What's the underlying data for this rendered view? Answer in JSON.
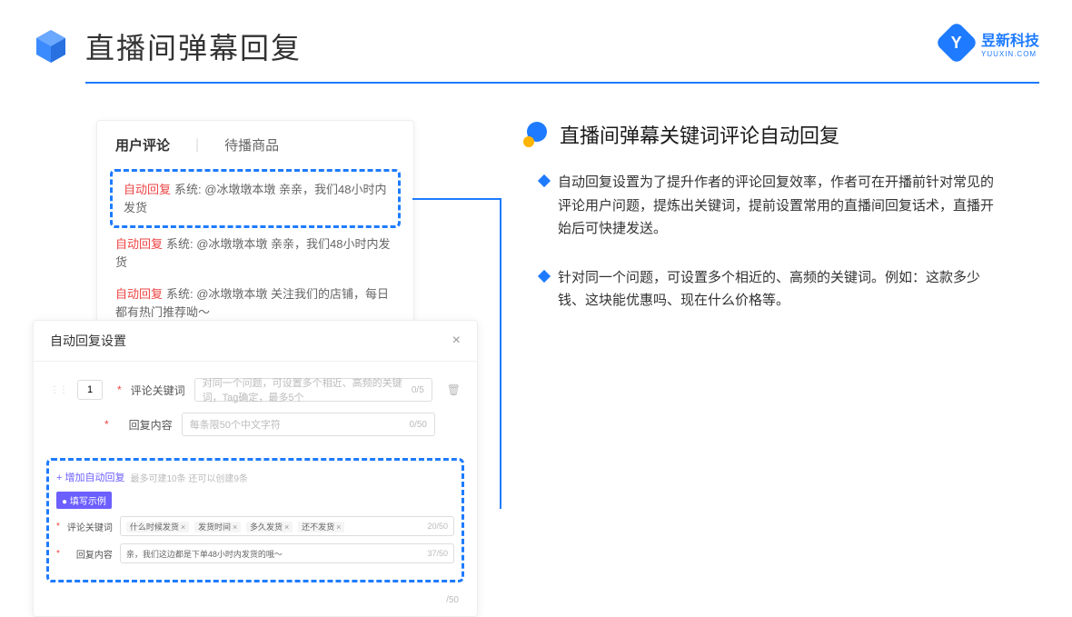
{
  "header": {
    "title": "直播间弹幕回复"
  },
  "brand": {
    "name": "昱新科技",
    "sub": "YUUXIN.COM",
    "letter": "Y"
  },
  "card1": {
    "tabs": {
      "active": "用户评论",
      "inactive": "待播商品"
    },
    "highlight": {
      "prefix": "自动回复",
      "text": "系统: @冰墩墩本墩 亲亲，我们48小时内发货"
    },
    "line2": {
      "prefix": "自动回复",
      "text": "系统: @冰墩墩本墩 亲亲，我们48小时内发货"
    },
    "line3": {
      "prefix": "自动回复",
      "text": "系统: @冰墩墩本墩 关注我们的店铺，每日都有热门推荐呦～"
    }
  },
  "card2": {
    "title": "自动回复设置",
    "num": "1",
    "kw_label": "评论关键词",
    "kw_placeholder": "对同一个问题，可设置多个相近、高频的关键词，Tag确定，最多5个",
    "kw_count": "0/5",
    "content_label": "回复内容",
    "content_placeholder": "每条限50个中文字符",
    "content_count": "0/50",
    "add_text": "+ 增加自动回复",
    "add_hint": "最多可建10条 还可以创建9条",
    "example_badge": "● 填写示例",
    "ex_kw_label": "评论关键词",
    "ex_tags": [
      "什么时候发货",
      "发货时间",
      "多久发货",
      "还不发货"
    ],
    "ex_kw_count": "20/50",
    "ex_content_label": "回复内容",
    "ex_content_value": "亲，我们这边都是下单48小时内发货的哦～",
    "ex_content_count": "37/50",
    "outer_count": "/50"
  },
  "right": {
    "heading": "直播间弹幕关键词评论自动回复",
    "bullets": [
      "自动回复设置为了提升作者的评论回复效率，作者可在开播前针对常见的评论用户问题，提炼出关键词，提前设置常用的直播间回复话术，直播开始后可快捷发送。",
      "针对同一个问题，可设置多个相近的、高频的关键词。例如：这款多少钱、这块能优惠吗、现在什么价格等。"
    ]
  }
}
